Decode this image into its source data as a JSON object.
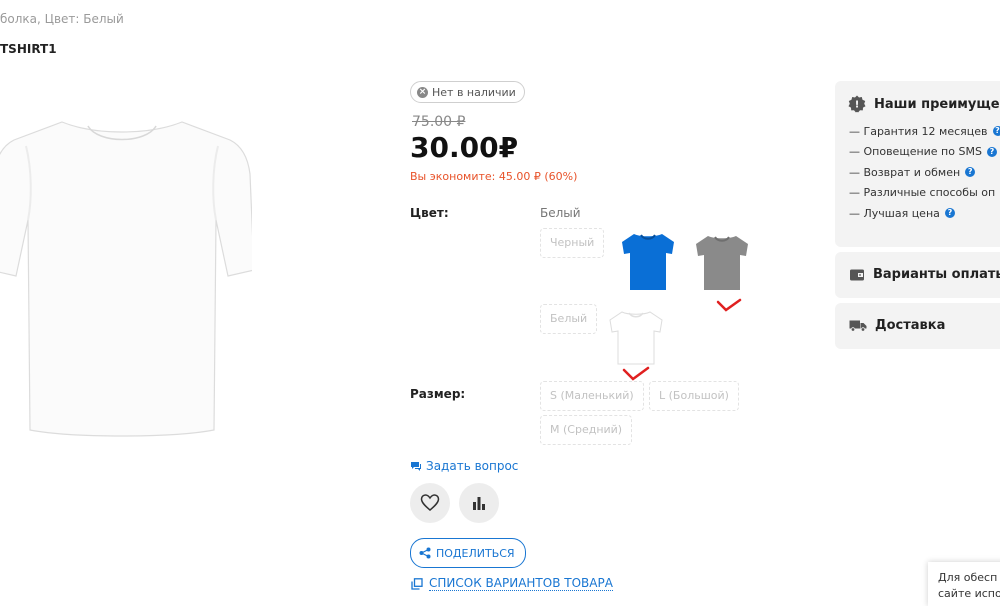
{
  "breadcrumb": "болка, Цвет: Белый",
  "sku": "TSHIRT1",
  "stock_badge": "Нет в наличии",
  "old_price": "75.00 ₽",
  "price": "30.00₽",
  "savings": "Вы экономите: 45.00 ₽ (60%)",
  "color": {
    "label": "Цвет:",
    "selected": "Белый",
    "options": [
      "Черный",
      "Белый"
    ],
    "thumb_colors": {
      "blue": "#0a6fd6",
      "gray": "#8a8a8a",
      "white": "#ffffff"
    }
  },
  "size": {
    "label": "Размер:",
    "options": [
      "S (Маленький)",
      "L (Большой)",
      "M (Средний)"
    ]
  },
  "ask_question": "Задать вопрос",
  "share": "ПОДЕЛИТЬСЯ",
  "variants_list": "СПИСОК ВАРИАНТОВ ТОВАРА",
  "advantages": {
    "title": "Наши преимущест",
    "items": [
      "— Гарантия 12 месяцев",
      "— Оповещение по SMS",
      "— Возврат и обмен",
      "— Различные способы оп",
      "— Лучшая цена"
    ]
  },
  "payment": {
    "title": "Варианты оплаты"
  },
  "delivery": {
    "title": "Доставка"
  },
  "cookie": {
    "line1": "Для обесп",
    "line2": "сайте испо"
  },
  "accent_color": "#1976d2",
  "savings_color": "#e8532a"
}
